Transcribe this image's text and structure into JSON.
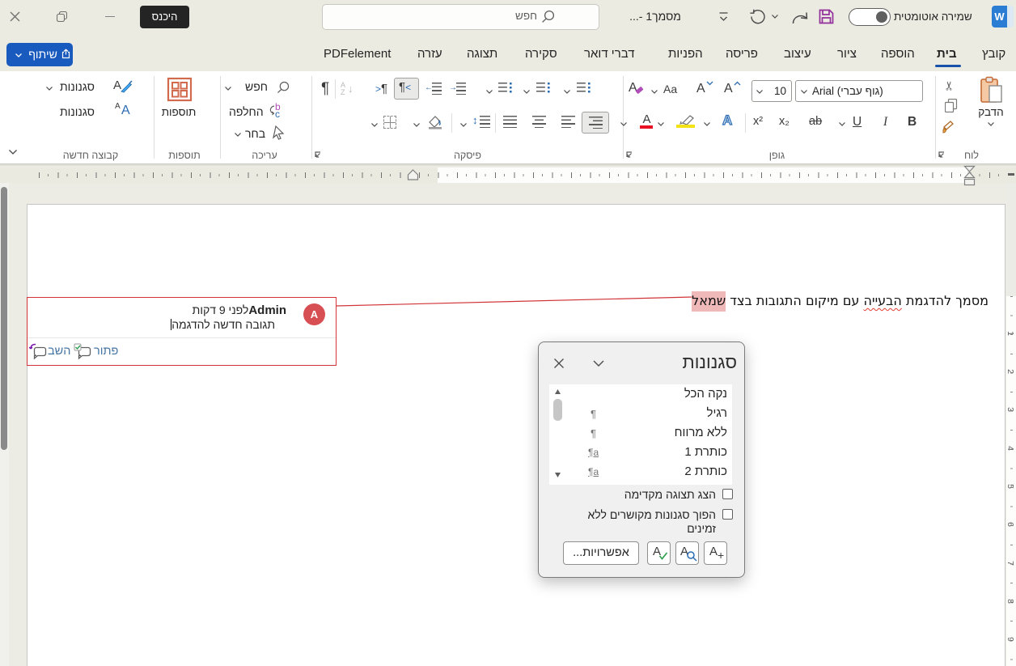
{
  "titlebar": {
    "signin_tooltip": "היכנס",
    "search_placeholder": "חפש",
    "document_title": "מסמך1 -...",
    "autosave_label": "שמירה אוטומטית",
    "logo_letter": "W"
  },
  "share": {
    "label": "שיתוף"
  },
  "tabs": [
    {
      "label": "PDFelement"
    },
    {
      "label": "עזרה"
    },
    {
      "label": "תצוגה"
    },
    {
      "label": "סקירה"
    },
    {
      "label": "דברי דואר"
    },
    {
      "label": "הפניות"
    },
    {
      "label": "פריסה"
    },
    {
      "label": "עיצוב"
    },
    {
      "label": "ציור"
    },
    {
      "label": "הוספה"
    },
    {
      "label": "בית"
    },
    {
      "label": "קובץ"
    }
  ],
  "ribbon": {
    "clipboard": {
      "paste_label": "הדבק",
      "group_label": "לוח"
    },
    "font": {
      "name": "Arial (גוף עברי)",
      "size": "10",
      "group_label": "גופן",
      "bold": "B",
      "italic": "I",
      "underline": "U",
      "strikethrough": "ab",
      "subscript": "x₂",
      "superscript": "x²",
      "case_label": "Aa",
      "grow": "A",
      "shrink": "A",
      "clear": "A",
      "effects": "A",
      "color": "A",
      "highlight_letters": ""
    },
    "paragraph": {
      "group_label": "פיסקה",
      "pilcrow": "¶",
      "rtl_mark": "¶",
      "ltr_mark": "¶"
    },
    "editing": {
      "find_label": "חפש",
      "replace_label": "החלפה",
      "select_label": "בחר",
      "group_label": "עריכה"
    },
    "addins": {
      "label": "תוספות",
      "group_label": "תוספות"
    },
    "custom_group": {
      "styles_gallery_label": "סגנונות",
      "styles_pane_label": "סגנונות",
      "group_label": "קבוצה חדשה"
    }
  },
  "document": {
    "text_start": "מסמך להדגמת ",
    "misspelled_word": "הבעייה",
    "text_middle": " עם מיקום התגובות בצד ",
    "highlighted_word": "שמאל"
  },
  "comment": {
    "author": "Admin",
    "time_ago": "לפני 9 דקות",
    "body": "תגובה חדשה להדגמה",
    "avatar_letter": "A",
    "reply_label": "השב",
    "resolve_label": "פתור"
  },
  "styles_panel": {
    "title": "סגנונות",
    "items": [
      {
        "label": "נקה הכל",
        "mark": ""
      },
      {
        "label": "רגיל",
        "mark": "¶"
      },
      {
        "label": "ללא מרווח",
        "mark": "¶"
      },
      {
        "label": "כותרת 1",
        "mark": "¶a"
      },
      {
        "label": "כותרת 2",
        "mark": "¶a"
      }
    ],
    "show_preview_label": "הצג תצוגה מקדימה",
    "disable_linked_label": "הפוך סגנונות מקושרים ללא זמינים",
    "options_label": "אפשרויות..."
  }
}
